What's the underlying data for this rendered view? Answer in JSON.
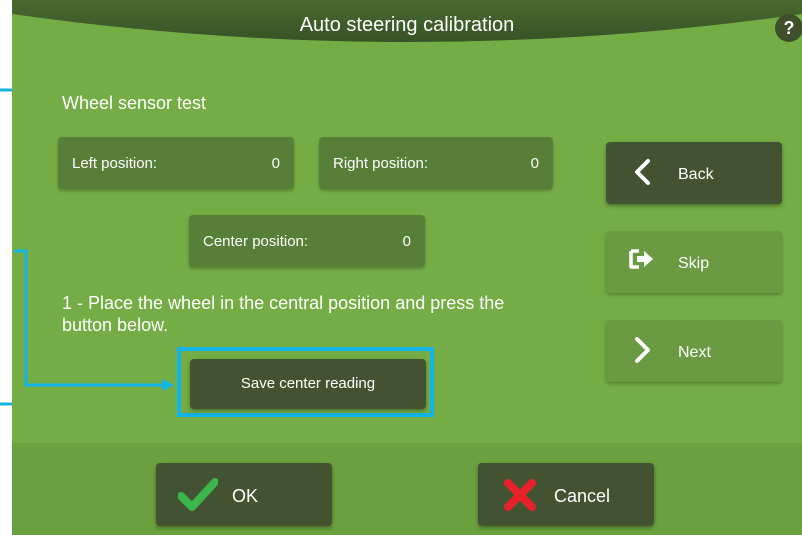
{
  "header": {
    "title": "Auto steering calibration",
    "help_label": "?"
  },
  "section": {
    "title": "Wheel sensor test"
  },
  "positions": {
    "left": {
      "label": "Left position:",
      "value": "0"
    },
    "right": {
      "label": "Right position:",
      "value": "0"
    },
    "center": {
      "label": "Center position:",
      "value": "0"
    }
  },
  "instruction": "1 - Place the wheel in the central position and press the button below.",
  "save_button": {
    "label": "Save center reading"
  },
  "nav": {
    "back": {
      "label": "Back",
      "icon": "chevron-left-icon"
    },
    "skip": {
      "label": "Skip",
      "icon": "skip-arrow-icon"
    },
    "next": {
      "label": "Next",
      "icon": "chevron-right-icon"
    }
  },
  "footer": {
    "ok": {
      "label": "OK",
      "icon": "checkmark-icon"
    },
    "cancel": {
      "label": "Cancel",
      "icon": "cross-icon"
    }
  },
  "colors": {
    "background": "#74ad45",
    "header_band": "#3f5b2a",
    "button_dark": "#435332",
    "field": "#577f37",
    "highlight": "#12b3e6",
    "ok_green": "#3cb54a",
    "cancel_red": "#e8222b"
  }
}
